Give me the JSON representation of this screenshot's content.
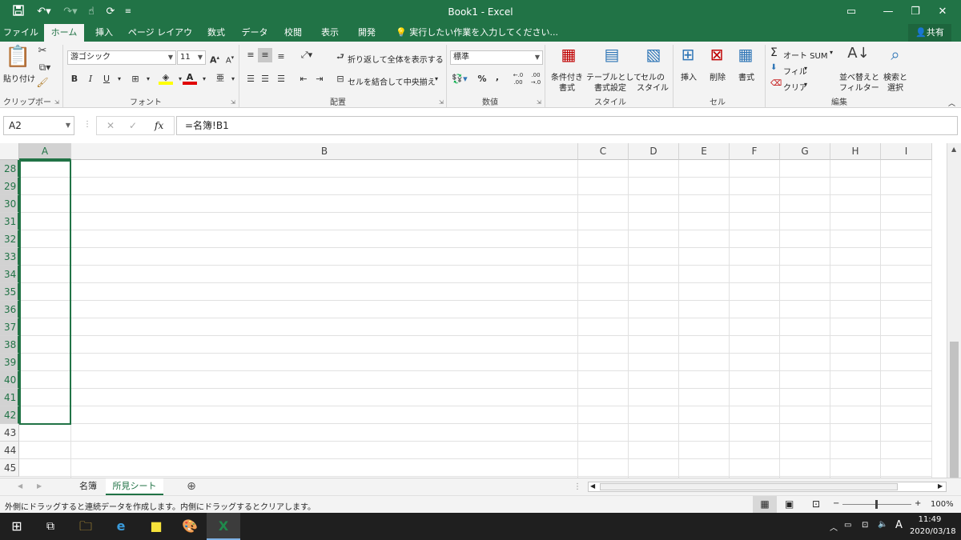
{
  "window": {
    "title": "Book1  -  Excel",
    "qat": {
      "save_icon": "save-icon",
      "undo_icon": "undo-icon",
      "redo_icon": "redo-icon",
      "touch_icon": "touch-mode-icon",
      "form_icon": "form-icon"
    },
    "controls": {
      "ribbon_display": "ribbon-display-icon",
      "minimize": "minimize-icon",
      "restore": "restore-icon",
      "close": "close-icon"
    }
  },
  "ribbon_tabs": [
    "ファイル",
    "ホーム",
    "挿入",
    "ページ レイアウト",
    "数式",
    "データ",
    "校閲",
    "表示",
    "開発"
  ],
  "active_tab": "ホーム",
  "tell_me": "実行したい作業を入力してください...",
  "share_label": "共有",
  "ribbon": {
    "clipboard": {
      "paste_label": "貼り付け",
      "group_label": "クリップボード"
    },
    "font": {
      "font_name": "游ゴシック",
      "font_size": "11",
      "bold": "B",
      "italic": "I",
      "underline": "U",
      "group_label": "フォント",
      "grow": "A",
      "shrink": "A"
    },
    "alignment": {
      "wrap_text": "折り返して全体を表示する",
      "merge_center": "セルを結合して中央揃え",
      "group_label": "配置"
    },
    "number": {
      "format": "標準",
      "percent": "%",
      "comma": ",",
      "inc_decimal": "←.0 .00",
      "dec_decimal": ".00 →.0",
      "group_label": "数値"
    },
    "styles": {
      "conditional": [
        "条件付き",
        "書式"
      ],
      "table": [
        "テーブルとして",
        "書式設定"
      ],
      "cell_styles": [
        "セルの",
        "スタイル"
      ],
      "group_label": "スタイル"
    },
    "cells": {
      "insert": "挿入",
      "delete": "削除",
      "format": "書式",
      "group_label": "セル"
    },
    "editing": {
      "autosum": "オート SUM",
      "fill": "フィル",
      "clear": "クリア",
      "sort_filter": [
        "並べ替えと",
        "フィルター"
      ],
      "find_select": [
        "検索と",
        "選択"
      ],
      "group_label": "編集"
    }
  },
  "formula_bar": {
    "name_box": "A2",
    "cancel": "✕",
    "enter": "✓",
    "fx": "fx",
    "formula": "=名簿!B1"
  },
  "grid": {
    "columns": [
      "A",
      "B",
      "C",
      "D",
      "E",
      "F",
      "G",
      "H",
      "I"
    ],
    "rows": [
      "28",
      "29",
      "30",
      "31",
      "32",
      "33",
      "34",
      "35",
      "36",
      "37",
      "38",
      "39",
      "40",
      "41",
      "42",
      "43",
      "44",
      "45"
    ],
    "selected_column": "A"
  },
  "sheets": [
    {
      "name": "名簿",
      "active": false
    },
    {
      "name": "所見シート",
      "active": true
    }
  ],
  "status": {
    "message": "外側にドラッグすると連続データを作成します。内側にドラッグするとクリアします。",
    "zoom": "100%"
  },
  "taskbar": {
    "time": "11:49",
    "date": "2020/03/18",
    "ime": "A"
  },
  "colors": {
    "accent": "#217346",
    "taskbar": "#1f1f1f"
  }
}
